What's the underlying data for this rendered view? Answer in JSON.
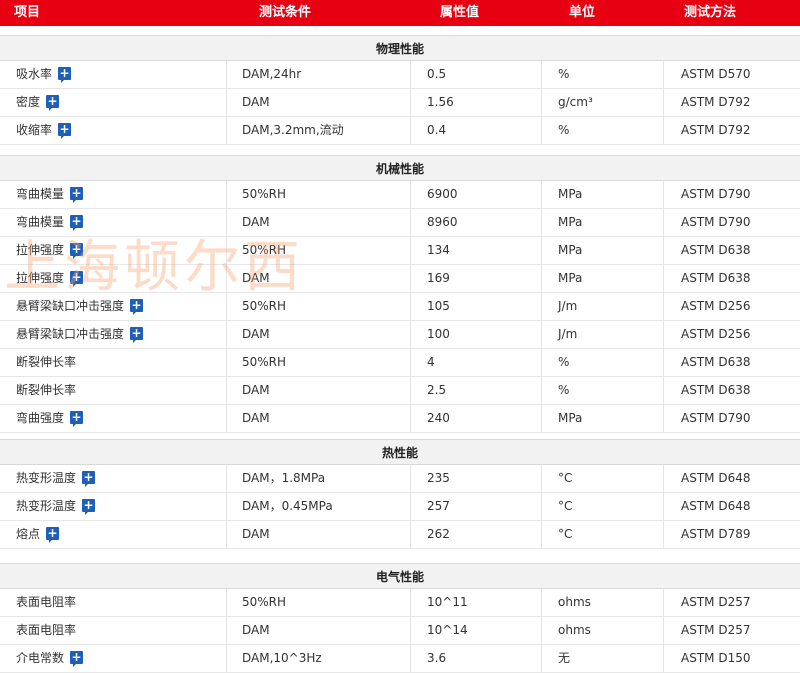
{
  "header": {
    "item": "项目",
    "condition": "测试条件",
    "value": "属性值",
    "unit": "单位",
    "method": "测试方法"
  },
  "accent_color": "#e60012",
  "watermark": "上海顿尔西",
  "sections": [
    {
      "title": "物理性能",
      "rows": [
        {
          "name": "吸水率",
          "has_icon": true,
          "condition": "DAM,24hr",
          "value": "0.5",
          "unit": "%",
          "method": "ASTM D570"
        },
        {
          "name": "密度",
          "has_icon": true,
          "condition": "DAM",
          "value": "1.56",
          "unit": "g/cm³",
          "method": "ASTM D792"
        },
        {
          "name": "收缩率",
          "has_icon": true,
          "condition": "DAM,3.2mm,流动",
          "value": "0.4",
          "unit": "%",
          "method": "ASTM D792"
        }
      ]
    },
    {
      "title": "机械性能",
      "rows": [
        {
          "name": "弯曲模量",
          "has_icon": true,
          "condition": "50%RH",
          "value": "6900",
          "unit": "MPa",
          "method": "ASTM D790"
        },
        {
          "name": "弯曲模量",
          "has_icon": true,
          "condition": "DAM",
          "value": "8960",
          "unit": "MPa",
          "method": "ASTM D790"
        },
        {
          "name": "拉伸强度",
          "has_icon": true,
          "condition": "50%RH",
          "value": "134",
          "unit": "MPa",
          "method": "ASTM D638"
        },
        {
          "name": "拉伸强度",
          "has_icon": true,
          "condition": "DAM",
          "value": "169",
          "unit": "MPa",
          "method": "ASTM D638"
        },
        {
          "name": "悬臂梁缺口冲击强度",
          "has_icon": true,
          "condition": "50%RH",
          "value": "105",
          "unit": "J/m",
          "method": "ASTM D256"
        },
        {
          "name": "悬臂梁缺口冲击强度",
          "has_icon": true,
          "condition": "DAM",
          "value": "100",
          "unit": "J/m",
          "method": "ASTM D256"
        },
        {
          "name": "断裂伸长率",
          "has_icon": false,
          "condition": "50%RH",
          "value": "4",
          "unit": "%",
          "method": "ASTM D638"
        },
        {
          "name": "断裂伸长率",
          "has_icon": false,
          "condition": "DAM",
          "value": "2.5",
          "unit": "%",
          "method": "ASTM D638"
        },
        {
          "name": "弯曲强度",
          "has_icon": true,
          "condition": "DAM",
          "value": "240",
          "unit": "MPa",
          "method": "ASTM D790"
        }
      ]
    },
    {
      "title": "热性能",
      "rows": [
        {
          "name": "热变形温度",
          "has_icon": true,
          "condition": "DAM，1.8MPa",
          "value": "235",
          "unit": "°C",
          "method": "ASTM D648"
        },
        {
          "name": "热变形温度",
          "has_icon": true,
          "condition": "DAM，0.45MPa",
          "value": "257",
          "unit": "°C",
          "method": "ASTM D648"
        },
        {
          "name": "熔点",
          "has_icon": true,
          "condition": "DAM",
          "value": "262",
          "unit": "°C",
          "method": "ASTM D789"
        }
      ]
    },
    {
      "title": "电气性能",
      "rows": [
        {
          "name": "表面电阻率",
          "has_icon": false,
          "condition": "50%RH",
          "value": "10^11",
          "unit": "ohms",
          "method": "ASTM D257"
        },
        {
          "name": "表面电阻率",
          "has_icon": false,
          "condition": "DAM",
          "value": "10^14",
          "unit": "ohms",
          "method": "ASTM D257"
        },
        {
          "name": "介电常数",
          "has_icon": true,
          "condition": "DAM,10^3Hz",
          "value": "3.6",
          "unit": "无",
          "method": "ASTM D150"
        }
      ]
    }
  ]
}
